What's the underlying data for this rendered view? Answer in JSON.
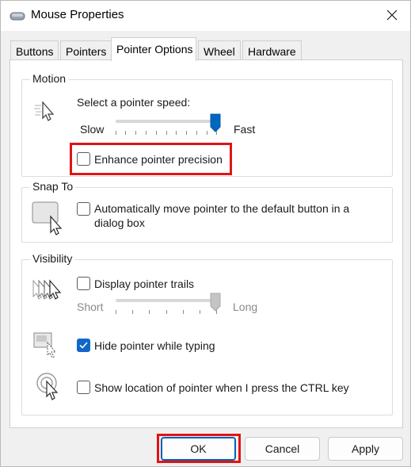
{
  "window": {
    "title": "Mouse Properties",
    "close_icon": "close-icon",
    "app_icon": "mouse-icon"
  },
  "tabs": [
    {
      "label": "Buttons",
      "active": false
    },
    {
      "label": "Pointers",
      "active": false
    },
    {
      "label": "Pointer Options",
      "active": true
    },
    {
      "label": "Wheel",
      "active": false
    },
    {
      "label": "Hardware",
      "active": false
    }
  ],
  "motion": {
    "group_label": "Motion",
    "speed_label": "Select a pointer speed:",
    "slow_label": "Slow",
    "fast_label": "Fast",
    "speed_level": 1.0,
    "enhance_label": "Enhance pointer precision",
    "enhance_checked": false
  },
  "snap_to": {
    "group_label": "Snap To",
    "auto_move_label_line1": "Automatically move pointer to the default button in a",
    "auto_move_label_line2": "dialog box",
    "auto_move_checked": false
  },
  "visibility": {
    "group_label": "Visibility",
    "trails_label": "Display pointer trails",
    "trails_checked": false,
    "short_label": "Short",
    "long_label": "Long",
    "trail_level": 1.0,
    "hide_label": "Hide pointer while typing",
    "hide_checked": true,
    "ctrl_label": "Show location of pointer when I press the CTRL key",
    "ctrl_checked": false
  },
  "buttons": {
    "ok": "OK",
    "cancel": "Cancel",
    "apply": "Apply"
  },
  "colors": {
    "accent": "#005fb8",
    "checkbox_checked": "#1167c8",
    "highlight": "#e11414"
  }
}
